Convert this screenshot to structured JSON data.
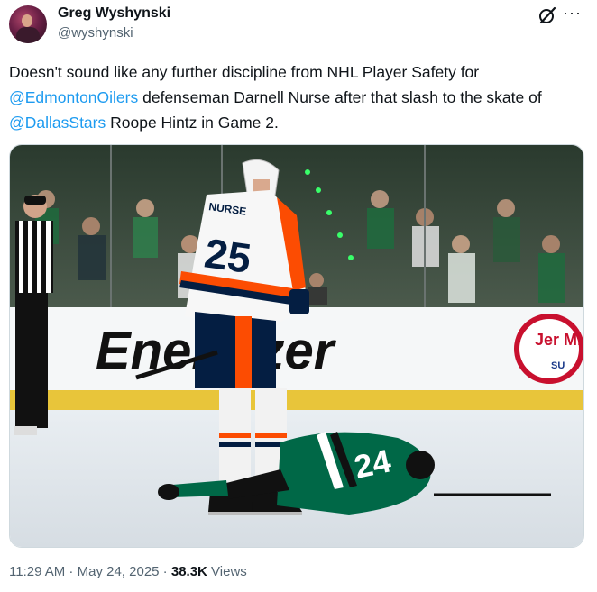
{
  "author": {
    "display_name": "Greg Wyshynski",
    "handle": "@wyshynski"
  },
  "header_icons": {
    "grok": "grok-icon",
    "more": "···"
  },
  "tweet": {
    "text_1": "Doesn't sound like any further discipline from NHL Player Safety for",
    "mention_1": "@EdmontonOilers",
    "text_2": " defenseman Darnell Nurse after that slash to the skate of ",
    "mention_2": "@DallasStars",
    "text_3": " Roope Hintz in Game 2."
  },
  "media": {
    "board_brand": "Energizer",
    "board_partial": "Jer Mi",
    "board_partial_2": "SU",
    "player_number": "25",
    "player_name_partial": "NURSE",
    "downed_player_number": "24"
  },
  "meta": {
    "time": "11:29 AM",
    "sep1": " · ",
    "date": "May 24, 2025",
    "sep2": " · ",
    "views_count": "38.3K",
    "views_label": " Views"
  },
  "colors": {
    "link": "#1d9bf0",
    "secondary_text": "#536471",
    "oilers_orange": "#fc4c02",
    "oilers_blue": "#041e42",
    "stars_green": "#006847"
  }
}
